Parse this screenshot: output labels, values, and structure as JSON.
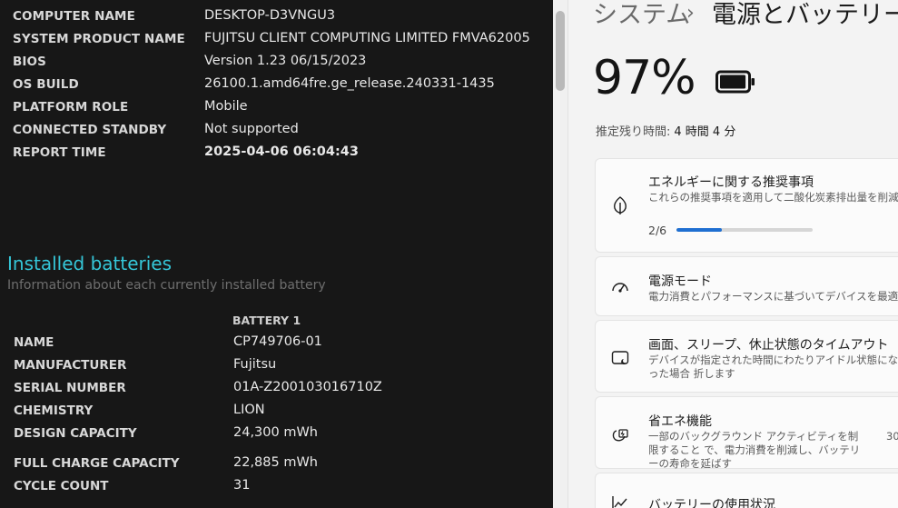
{
  "report": {
    "system": [
      {
        "key": "COMPUTER NAME",
        "value": "DESKTOP-D3VNGU3"
      },
      {
        "key": "SYSTEM PRODUCT NAME",
        "value": "FUJITSU CLIENT COMPUTING LIMITED FMVA62005"
      },
      {
        "key": "BIOS",
        "value": "Version 1.23 06/15/2023"
      },
      {
        "key": "OS BUILD",
        "value": "26100.1.amd64fre.ge_release.240331-1435"
      },
      {
        "key": "PLATFORM ROLE",
        "value": "Mobile"
      },
      {
        "key": "CONNECTED STANDBY",
        "value": "Not supported"
      },
      {
        "key": "REPORT TIME",
        "value": "2025-04-06  06:04:43"
      }
    ],
    "section_title": "Installed batteries",
    "section_subtitle": "Information about each currently installed battery",
    "battery_header": "BATTERY 1",
    "battery": [
      {
        "key": "NAME",
        "value": "CP749706-01"
      },
      {
        "key": "MANUFACTURER",
        "value": "Fujitsu"
      },
      {
        "key": "SERIAL NUMBER",
        "value": "01A-Z200103016710Z"
      },
      {
        "key": "CHEMISTRY",
        "value": "LION"
      },
      {
        "key": "DESIGN CAPACITY",
        "value": "24,300 mWh"
      },
      {
        "key": "FULL CHARGE CAPACITY",
        "value": "22,885 mWh"
      },
      {
        "key": "CYCLE COUNT",
        "value": "31"
      }
    ]
  },
  "settings": {
    "breadcrumb_parent": "システム",
    "breadcrumb_separator": "›",
    "breadcrumb_current": "電源とバッテリー",
    "battery_percent": "97%",
    "battery_level": 0.97,
    "estimate_label": "推定残り時間:",
    "estimate_value": "4 時間 4 分",
    "cards": {
      "energy": {
        "icon": "leaf-icon",
        "title": "エネルギーに関する推奨事項",
        "subtitle": "これらの推奨事項を適用して二酸化炭素排出量を削減す",
        "progress_label": "2/6",
        "progress_fraction": 0.333
      },
      "power_mode": {
        "icon": "gauge-icon",
        "title": "電源モード",
        "subtitle": "電力消費とパフォーマンスに基づいてデバイスを最適化"
      },
      "screen_sleep": {
        "icon": "screen-sleep-icon",
        "title": "画面、スリープ、休止状態のタイムアウト",
        "subtitle": "デバイスが指定された時間にわたりアイドル状態になった場合 折します"
      },
      "energy_saver": {
        "icon": "energy-saver-icon",
        "title": "省エネ機能",
        "subtitle": "一部のバックグラウンド アクティビティを制限すること で、電力消費を削減し、バッテリーの寿命を延ばす",
        "trailing": "30"
      },
      "battery_usage": {
        "icon": "usage-chart-icon",
        "title": "バッテリーの使用状況"
      }
    },
    "accent_color": "#1f6fd1"
  }
}
